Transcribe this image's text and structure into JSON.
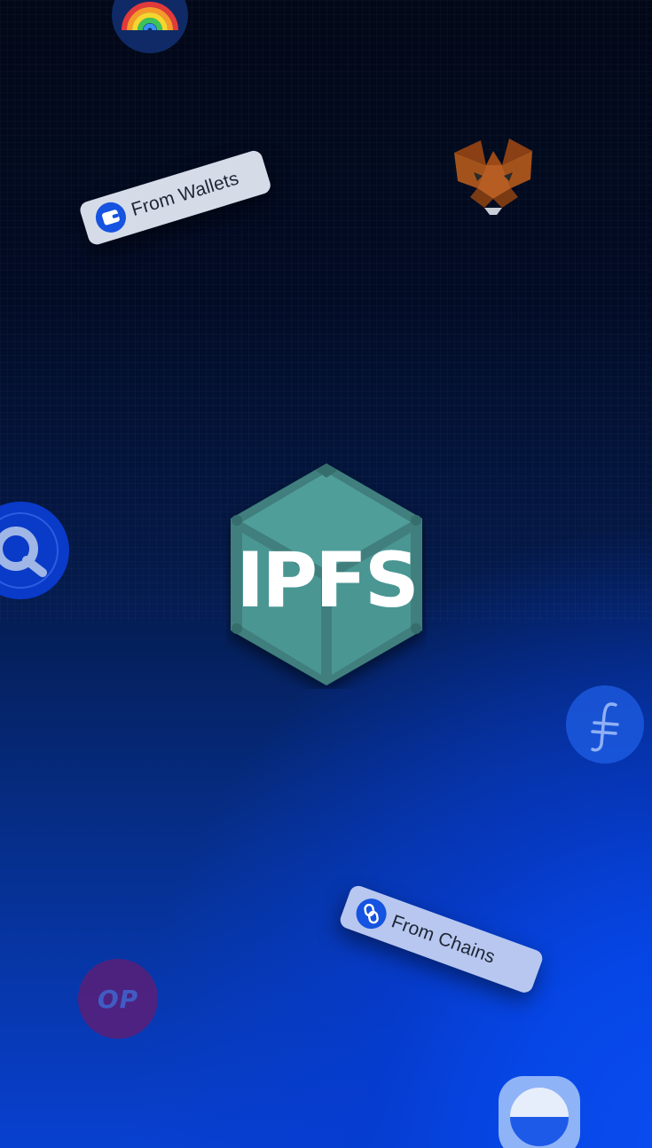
{
  "hero": {
    "logo_text": "IPFS"
  },
  "pills": {
    "wallets_label": "From Wallets",
    "chains_label": "From Chains"
  },
  "floating_icons": {
    "optimism_label": "OP"
  },
  "colors": {
    "accent_blue": "#0a4cf0",
    "ipfs_teal": "#4a9c98",
    "pill_wallets_bg": "#d6dbe8",
    "pill_chains_bg": "#b7c7f0"
  },
  "icons": [
    "rainbow-icon",
    "metamask-fox-icon",
    "wallet-icon",
    "chain-link-icon",
    "search-icon",
    "filecoin-icon",
    "optimism-icon",
    "circle-app-icon"
  ]
}
